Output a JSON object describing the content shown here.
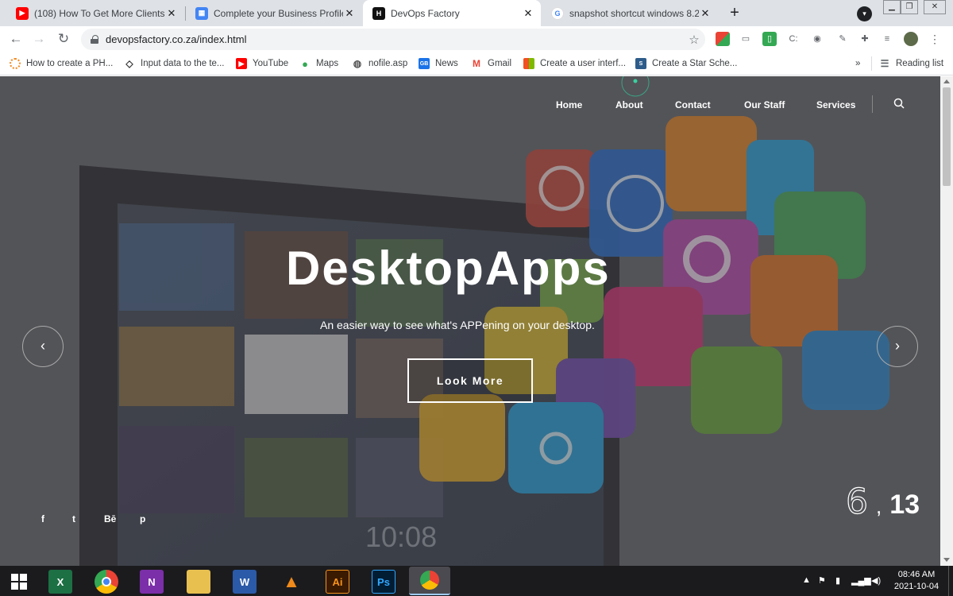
{
  "browser": {
    "tabs": [
      {
        "title": "(108) How To Get More Clients Fr",
        "icon": "youtube-icon"
      },
      {
        "title": "Complete your Business Profile |",
        "icon": "business-profile-icon"
      },
      {
        "title": "DevOps Factory",
        "icon": "devops-factory-icon",
        "active": true
      },
      {
        "title": "snapshot shortcut windows 8.2 -",
        "icon": "google-icon"
      }
    ],
    "url": "devopsfactory.co.za/index.html",
    "bookmarks": [
      {
        "label": "How to create a PH...",
        "icon": "orange-ring-icon"
      },
      {
        "label": "Input data to the te...",
        "icon": "diamond-icon"
      },
      {
        "label": "YouTube",
        "icon": "youtube-icon"
      },
      {
        "label": "Maps",
        "icon": "maps-pin-icon"
      },
      {
        "label": "nofile.asp",
        "icon": "globe-icon"
      },
      {
        "label": "News",
        "icon": "news-icon"
      },
      {
        "label": "Gmail",
        "icon": "gmail-icon"
      },
      {
        "label": "Create a user interf...",
        "icon": "microsoft-icon"
      },
      {
        "label": "Create a Star Sche...",
        "icon": "sqlservercentral-icon"
      }
    ],
    "reading_list": "Reading list",
    "more_bookmarks": "»"
  },
  "site": {
    "nav": [
      "Home",
      "About",
      "Contact",
      "Our Staff",
      "Services"
    ],
    "hero": {
      "title": "DesktopApps",
      "subtitle": "An easier way to see what's APPening on your desktop.",
      "cta": "Look More",
      "monitor_clock": "10:08"
    },
    "slide_current": "6",
    "slide_separator": ",",
    "slide_total": "13",
    "social": [
      "f",
      "t",
      "Bē",
      "p"
    ]
  },
  "taskbar": {
    "apps": [
      "excel-icon",
      "chrome-icon",
      "onenote-icon",
      "file-explorer-icon",
      "word-icon",
      "vlc-icon",
      "illustrator-icon",
      "photoshop-icon",
      "chrome-active-icon"
    ],
    "time": "08:46 AM",
    "date": "2021-10-04"
  },
  "colors": {
    "chrome_tabstrip": "#dee1e6",
    "hero_overlay": "#5a5b5f",
    "taskbar": "#1b1b1e"
  }
}
